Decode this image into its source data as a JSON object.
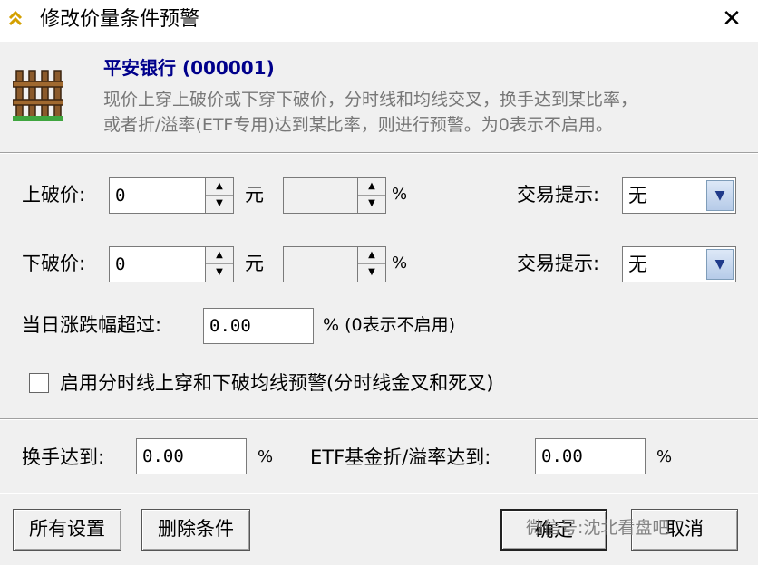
{
  "window": {
    "title": "修改价量条件预警",
    "close_label": "✕"
  },
  "header": {
    "stock_name": "平安银行 (000001)",
    "description_line1": "现价上穿上破价或下穿下破价，分时线和均线交叉，换手达到某比率，",
    "description_line2": "或者折/溢率(ETF专用)达到某比率，则进行预警。为0表示不启用。"
  },
  "upper": {
    "label": "上破价:",
    "price_value": "0",
    "price_unit": "元",
    "pct_value": "",
    "pct_unit": "%",
    "trade_hint_label": "交易提示:",
    "trade_hint_value": "无"
  },
  "lower": {
    "label": "下破价:",
    "price_value": "0",
    "price_unit": "元",
    "pct_value": "",
    "pct_unit": "%",
    "trade_hint_label": "交易提示:",
    "trade_hint_value": "无"
  },
  "daily_change": {
    "label": "当日涨跌幅超过:",
    "value": "0.00",
    "suffix": "% (0表示不启用)"
  },
  "ma_cross": {
    "label": "启用分时线上穿和下破均线预警(分时线金叉和死叉)",
    "checked": false
  },
  "turnover": {
    "label": "换手达到:",
    "value": "0.00",
    "unit": "%"
  },
  "etf": {
    "label": "ETF基金折/溢率达到:",
    "value": "0.00",
    "unit": "%"
  },
  "buttons": {
    "all_settings": "所有设置",
    "delete_condition": "删除条件",
    "ok": "确定",
    "cancel": "取消"
  },
  "watermark": "微信号:沈北看盘吧"
}
